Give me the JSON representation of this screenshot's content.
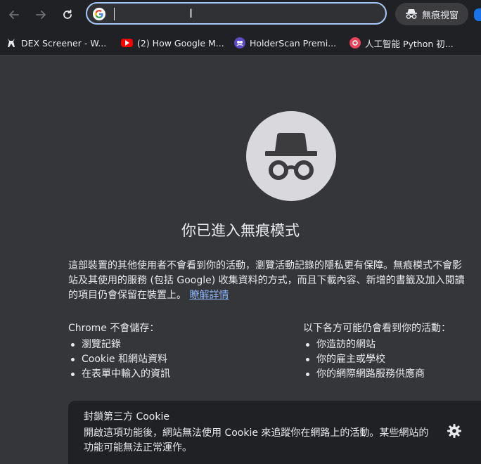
{
  "toolbar": {
    "omnibox_value": "",
    "incognito_label": "無痕視窗"
  },
  "bookmarks": [
    {
      "label": "DEX Screener - W...",
      "icon": "dex-screener-icon"
    },
    {
      "label": "(2) How Google M...",
      "icon": "youtube-icon"
    },
    {
      "label": "HolderScan Premi...",
      "icon": "holderscan-icon"
    },
    {
      "label": "人工智能 Python 初...",
      "icon": "ai-python-icon"
    }
  ],
  "main": {
    "title": "你已進入無痕模式",
    "paragraph_lines": [
      "這部裝置的其他使用者不會看到你的活動，瀏覽活動記錄的隱私更有保障。無痕模式不會影",
      "站及其使用的服務 (包括 Google) 收集資料的方式，而且下載內容、新增的書籤及加入閱讀",
      "的項目仍會保留在裝置上。"
    ],
    "learn_more": "瞭解詳情",
    "left_column": {
      "heading": "Chrome 不會儲存：",
      "items": [
        "瀏覽記錄",
        "Cookie 和網站資料",
        "在表單中輸入的資訊"
      ]
    },
    "right_column": {
      "heading": "以下各方可能仍會看到你的活動：",
      "items": [
        "你造訪的網站",
        "你的雇主或學校",
        "你的網際網路服務供應商"
      ]
    }
  },
  "cookie_card": {
    "title": "封鎖第三方 Cookie",
    "description": "開啟這項功能後，網站無法使用 Cookie 來追蹤你在網路上的活動。某些網站的功能可能無法正常運作。"
  },
  "colors": {
    "background": "#35363a",
    "toolbar": "#202124",
    "accent_focus": "#a8c7fa",
    "link": "#8ab4f8"
  }
}
